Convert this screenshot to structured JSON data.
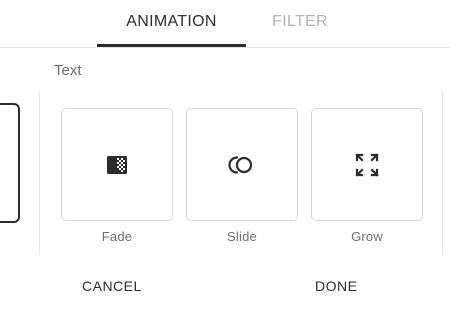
{
  "tabs": {
    "animation": "ANIMATION",
    "filter": "FILTER"
  },
  "section": {
    "label": "Text"
  },
  "options": {
    "fade": {
      "label": "Fade",
      "icon": "fade-icon"
    },
    "slide": {
      "label": "Slide",
      "icon": "slide-icon"
    },
    "grow": {
      "label": "Grow",
      "icon": "grow-icon"
    }
  },
  "actions": {
    "cancel": "CANCEL",
    "done": "DONE"
  },
  "colors": {
    "text": "#2c2c2c",
    "muted": "#6e6e6e",
    "inactive_tab": "#b3b3b3",
    "border": "#d9d9d9"
  }
}
